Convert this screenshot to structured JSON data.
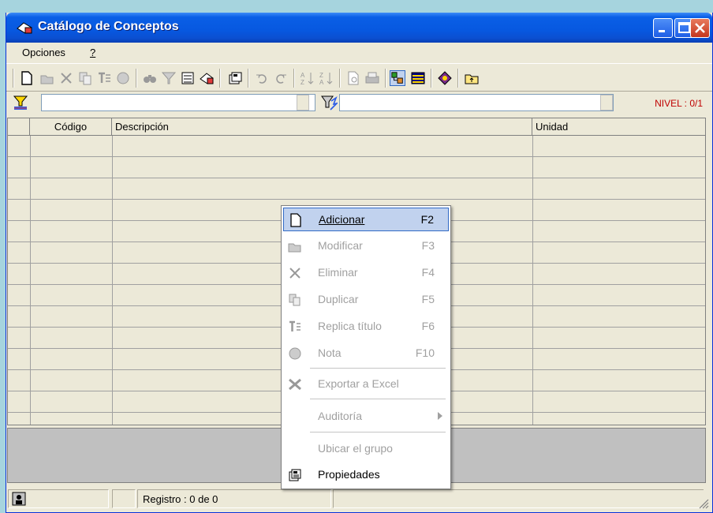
{
  "window": {
    "title": "Catálogo de Conceptos"
  },
  "menubar": {
    "items": [
      {
        "label": "Opciones"
      },
      {
        "label": "?"
      }
    ]
  },
  "filter": {
    "nivel": "NIVEL : 0/1"
  },
  "grid": {
    "columns": [
      "",
      "Código",
      "Descripción",
      "Unidad"
    ]
  },
  "statusbar": {
    "registro": "Registro :  0 de 0"
  },
  "context_menu": {
    "items": [
      {
        "label": "Adicionar",
        "shortcut": "F2",
        "icon": "new-doc-icon",
        "enabled": true,
        "selected": true
      },
      {
        "label": "Modificar",
        "shortcut": "F3",
        "icon": "open-folder-icon",
        "enabled": false
      },
      {
        "label": "Eliminar",
        "shortcut": "F4",
        "icon": "delete-x-icon",
        "enabled": false
      },
      {
        "label": "Duplicar",
        "shortcut": "F5",
        "icon": "duplicate-icon",
        "enabled": false
      },
      {
        "label": "Replica título",
        "shortcut": "F6",
        "icon": "replicate-title-icon",
        "enabled": false
      },
      {
        "label": "Nota",
        "shortcut": "F10",
        "icon": "note-icon",
        "enabled": false
      },
      {
        "label": "Exportar a Excel",
        "shortcut": "",
        "icon": "excel-icon",
        "enabled": false
      },
      {
        "label": "Auditoría",
        "shortcut": "",
        "icon": "",
        "enabled": false,
        "submenu": true
      },
      {
        "label": "Ubicar el grupo",
        "shortcut": "",
        "icon": "",
        "enabled": false
      },
      {
        "label": "Propiedades",
        "shortcut": "",
        "icon": "properties-icon",
        "enabled": true
      }
    ]
  },
  "colors": {
    "titlebar": "#0a5fe6",
    "selection": "#c1d2ee",
    "nivel": "#c00000"
  }
}
